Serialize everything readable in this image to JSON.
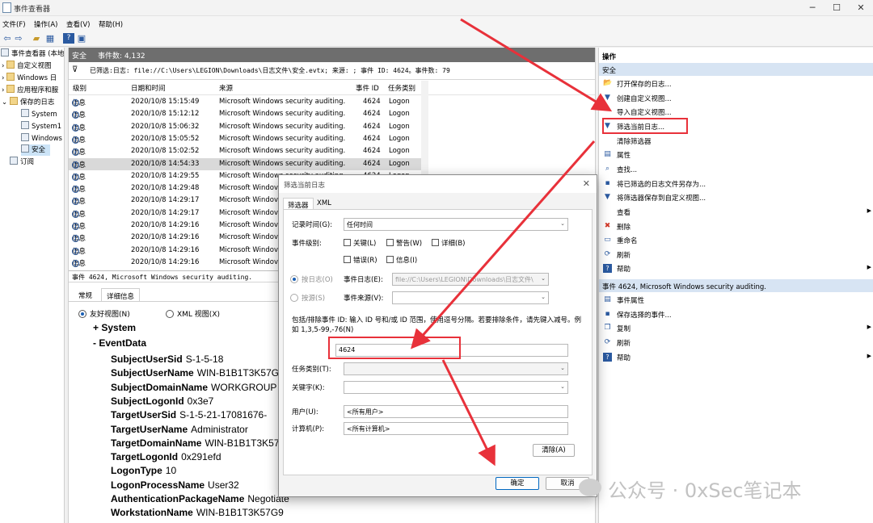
{
  "window": {
    "title": "事件查看器",
    "min": "─",
    "max": "☐",
    "close": "✕"
  },
  "menu": [
    "文件(F)",
    "操作(A)",
    "查看(V)",
    "帮助(H)"
  ],
  "tree": {
    "root": "事件查看器 (本地",
    "items": [
      "自定义视图",
      "Windows 日",
      "应用程序和服",
      "保存的日志",
      "System",
      "System1",
      "Windows",
      "安全",
      "订阅"
    ]
  },
  "log": {
    "name": "安全",
    "count_label": "事件数: 4,132",
    "filter_text": "已筛选:日志: file://C:\\Users\\LEGION\\Downloads\\日志文件\\安全.evtx; 来源: ; 事件 ID: 4624。事件数: 79",
    "columns": [
      "级别",
      "日期和时间",
      "来源",
      "事件 ID",
      "任务类别"
    ],
    "rows": [
      {
        "level": "信息",
        "time": "2020/10/8 15:15:49",
        "source": "Microsoft Windows security auditing.",
        "id": "4624",
        "task": "Logon"
      },
      {
        "level": "信息",
        "time": "2020/10/8 15:12:12",
        "source": "Microsoft Windows security auditing.",
        "id": "4624",
        "task": "Logon"
      },
      {
        "level": "信息",
        "time": "2020/10/8 15:06:32",
        "source": "Microsoft Windows security auditing.",
        "id": "4624",
        "task": "Logon"
      },
      {
        "level": "信息",
        "time": "2020/10/8 15:05:52",
        "source": "Microsoft Windows security auditing.",
        "id": "4624",
        "task": "Logon"
      },
      {
        "level": "信息",
        "time": "2020/10/8 15:02:52",
        "source": "Microsoft Windows security auditing.",
        "id": "4624",
        "task": "Logon"
      },
      {
        "level": "信息",
        "time": "2020/10/8 14:54:33",
        "source": "Microsoft Windows security auditing.",
        "id": "4624",
        "task": "Logon"
      },
      {
        "level": "信息",
        "time": "2020/10/8 14:29:55",
        "source": "Microsoft Windows security auditing.",
        "id": "4624",
        "task": "Logon"
      },
      {
        "level": "信息",
        "time": "2020/10/8 14:29:48",
        "source": "Microsoft Windov",
        "id": "",
        "task": ""
      },
      {
        "level": "信息",
        "time": "2020/10/8 14:29:17",
        "source": "Microsoft Windov",
        "id": "",
        "task": ""
      },
      {
        "level": "信息",
        "time": "2020/10/8 14:29:17",
        "source": "Microsoft Windov",
        "id": "",
        "task": ""
      },
      {
        "level": "信息",
        "time": "2020/10/8 14:29:16",
        "source": "Microsoft Windov",
        "id": "",
        "task": ""
      },
      {
        "level": "信息",
        "time": "2020/10/8 14:29:16",
        "source": "Microsoft Windov",
        "id": "",
        "task": ""
      },
      {
        "level": "信息",
        "time": "2020/10/8 14:29:16",
        "source": "Microsoft Windov",
        "id": "",
        "task": ""
      },
      {
        "level": "信息",
        "time": "2020/10/8 14:29:16",
        "source": "Microsoft Windov",
        "id": "",
        "task": ""
      }
    ]
  },
  "detail": {
    "header": "事件 4624, Microsoft Windows security auditing.",
    "tabs": [
      "常规",
      "详细信息"
    ],
    "view_friendly": "友好视图(N)",
    "view_xml": "XML 视图(X)",
    "system_label": "+ System",
    "eventdata_label": "-  EventData",
    "fields": [
      {
        "k": "SubjectUserSid",
        "v": "S-1-5-18"
      },
      {
        "k": "SubjectUserName",
        "v": "WIN-B1B1T3K57G9"
      },
      {
        "k": "SubjectDomainName",
        "v": "WORKGROUP"
      },
      {
        "k": "SubjectLogonId",
        "v": "0x3e7"
      },
      {
        "k": "TargetUserSid",
        "v": "S-1-5-21-17081676-"
      },
      {
        "k": "TargetUserName",
        "v": "Administrator"
      },
      {
        "k": "TargetDomainName",
        "v": "WIN-B1B1T3K57"
      },
      {
        "k": "TargetLogonId",
        "v": "0x291efd"
      },
      {
        "k": "LogonType",
        "v": "10"
      },
      {
        "k": "LogonProcessName",
        "v": "User32"
      },
      {
        "k": "AuthenticationPackageName",
        "v": "Negotiate"
      },
      {
        "k": "WorkstationName",
        "v": "WIN-B1B1T3K57G9"
      }
    ]
  },
  "actions": {
    "title": "操作",
    "section1": "安全",
    "items1": [
      {
        "label": "打开保存的日志...",
        "icon": "open-icon",
        "glyph": "📂",
        "arrow": false
      },
      {
        "label": "创建自定义视图...",
        "icon": "filter-create-icon",
        "glyph": "▼",
        "arrow": false
      },
      {
        "label": "导入自定义视图...",
        "icon": "import-icon",
        "glyph": "",
        "arrow": false
      },
      {
        "label": "筛选当前日志...",
        "icon": "filter-icon",
        "glyph": "▼",
        "arrow": false
      },
      {
        "label": "清除筛选器",
        "icon": "clear-filter-icon",
        "glyph": "",
        "arrow": false
      },
      {
        "label": "属性",
        "icon": "properties-icon",
        "glyph": "▤",
        "arrow": false
      },
      {
        "label": "查找...",
        "icon": "find-icon",
        "glyph": "⌕",
        "arrow": false
      },
      {
        "label": "将已筛选的日志文件另存为...",
        "icon": "save-icon",
        "glyph": "▪",
        "arrow": false
      },
      {
        "label": "将筛选器保存到自定义视图...",
        "icon": "save-filter-icon",
        "glyph": "▼",
        "arrow": false
      },
      {
        "label": "查看",
        "icon": "view-icon",
        "glyph": "",
        "arrow": true
      },
      {
        "label": "删除",
        "icon": "delete-icon",
        "glyph": "✖",
        "arrow": false
      },
      {
        "label": "重命名",
        "icon": "rename-icon",
        "glyph": "▭",
        "arrow": false
      },
      {
        "label": "刷新",
        "icon": "refresh-icon",
        "glyph": "⟳",
        "arrow": false
      },
      {
        "label": "帮助",
        "icon": "help-icon",
        "glyph": "?",
        "arrow": true
      }
    ],
    "section2": "事件 4624, Microsoft Windows security auditing.",
    "items2": [
      {
        "label": "事件属性",
        "icon": "event-properties-icon",
        "glyph": "▤",
        "arrow": false
      },
      {
        "label": "保存选择的事件...",
        "icon": "save-event-icon",
        "glyph": "▪",
        "arrow": false
      },
      {
        "label": "复制",
        "icon": "copy-icon",
        "glyph": "❐",
        "arrow": true
      },
      {
        "label": "刷新",
        "icon": "refresh-icon",
        "glyph": "⟳",
        "arrow": false
      },
      {
        "label": "帮助",
        "icon": "help-icon",
        "glyph": "?",
        "arrow": true
      }
    ]
  },
  "dialog": {
    "title": "筛选当前日志",
    "close": "✕",
    "tabs": [
      "筛选器",
      "XML"
    ],
    "logged_label": "记录时间(G):",
    "logged_value": "任何时间",
    "level_label": "事件级别:",
    "levels": [
      "关键(L)",
      "警告(W)",
      "详细(B)",
      "错误(R)",
      "信息(I)"
    ],
    "by_log": "按日志(O)",
    "event_log_label": "事件日志(E):",
    "event_log_value": "file://C:\\Users\\LEGION\\Downloads\\日志文件\\",
    "by_source": "按源(S)",
    "event_source_label": "事件来源(V):",
    "event_source_value": "",
    "hint": "包括/排除事件 ID: 输入 ID 号和/或 ID 范围，使用逗号分隔。若要排除条件，请先键入减号。例如 1,3,5-99,-76(N)",
    "event_id": "4624",
    "task_label": "任务类别(T):",
    "keyword_label": "关键字(K):",
    "user_label": "用户(U):",
    "user_value": "<所有用户>",
    "computer_label": "计算机(P):",
    "computer_value": "<所有计算机>",
    "clear_btn": "清除(A)",
    "ok_btn": "确定",
    "cancel_btn": "取消"
  },
  "watermark": "公众号 · 0xSec笔记本",
  "colors": {
    "highlight": "#e8313a",
    "selection": "#cce4f7",
    "header": "#6e6e6e"
  }
}
